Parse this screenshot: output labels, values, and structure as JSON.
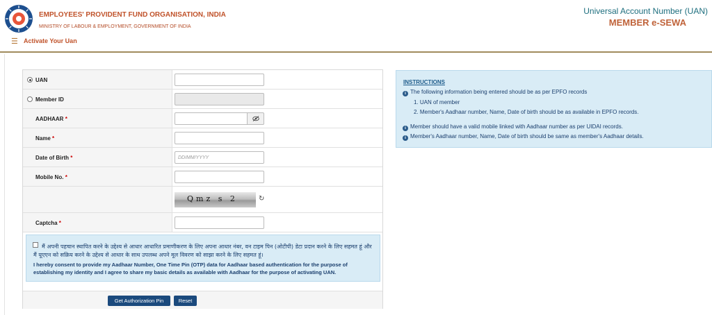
{
  "header": {
    "org_name": "EMPLOYEES' PROVIDENT FUND ORGANISATION, INDIA",
    "ministry": "MINISTRY OF LABOUR & EMPLOYMENT, GOVERNMENT OF INDIA",
    "portal_title": "Universal Account Number (UAN)",
    "portal_subtitle": "MEMBER e-SEWA"
  },
  "subbar": {
    "page_title": "Activate Your Uan",
    "menu_icon": "hamburger-icon"
  },
  "form": {
    "uan_label": "UAN",
    "member_id_label": "Member ID",
    "aadhaar_label": "AADHAAR",
    "name_label": "Name",
    "dob_label": "Date of Birth",
    "dob_placeholder": "DD/MM/YYYY",
    "mobile_label": "Mobile No.",
    "captcha_label": "Captcha",
    "captcha_text": "Qmz s 2",
    "required_mark": "*",
    "selected_option": "UAN"
  },
  "consent": {
    "hindi": "मैं अपनी पहचान स्थापित करने के उद्देश्य से आधार आधारित प्रमाणीकरण के लिए अपना आधार नंबर, वन टाइम पिन (ओटीपी) डेटा प्रदान करने के लिए सहमत हूं और मैं यूएएन को सक्रिय करने के उद्देश्य से आधार के साथ उपलब्ध अपने मूल विवरण को साझा करने के लिए सहमत हूं।",
    "english": "I hereby consent to provide my Aadhaar Number, One Time Pin (OTP) data for Aadhaar based authentication for the purpose of establishing my identity and I agree to share my basic details as available with Aadhaar for the purpose of activating UAN."
  },
  "buttons": {
    "get_pin": "Get Authorization Pin",
    "reset": "Reset"
  },
  "instructions": {
    "title": "INSTRUCTIONS",
    "line1": "The following information being entered should be as per EPFO records",
    "sub1": "1. UAN of member",
    "sub2": "2. Member's Aadhaar number, Name, Date of birth should be as available in EPFO records.",
    "line2": "Member should have a valid mobile linked with Aadhaar number as per UIDAI records.",
    "line3": "Member's Aadhaar number, Name, Date of birth should be same as member's Aadhaar details."
  },
  "colors": {
    "brand": "#c0522a",
    "accent": "#1b4a7d",
    "info_bg": "#d9ecf6"
  }
}
